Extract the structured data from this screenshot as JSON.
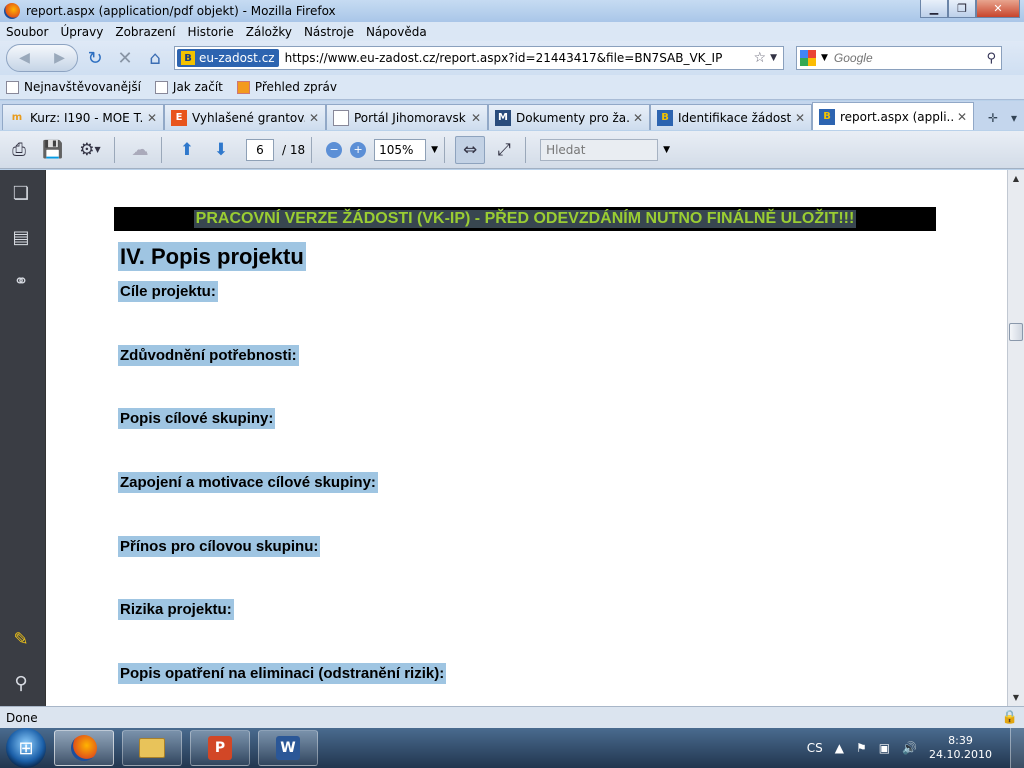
{
  "window": {
    "title": "report.aspx (application/pdf objekt) - Mozilla Firefox",
    "minimize": "▁",
    "maximize": "❐",
    "close": "✕"
  },
  "menu": [
    "Soubor",
    "Úpravy",
    "Zobrazení",
    "Historie",
    "Záložky",
    "Nástroje",
    "Nápověda"
  ],
  "nav": {
    "site_badge": "eu-zadost.cz",
    "url": "https://www.eu-zadost.cz/report.aspx?id=21443417&file=BN7SAB_VK_IP",
    "search_placeholder": "Google"
  },
  "bookmarks": [
    "Nejnavštěvovanější",
    "Jak začít",
    "Přehled zpráv"
  ],
  "tabs": [
    {
      "label": "Kurz: I190 - MOE T...",
      "icon": "moodle-icon"
    },
    {
      "label": "Vyhlašené grantov...",
      "icon": "e-logo-icon"
    },
    {
      "label": "Portál Jihomoravsk...",
      "icon": "page-icon"
    },
    {
      "label": "Dokumenty pro ža...",
      "icon": "msmt-icon"
    },
    {
      "label": "Identifikace žádosti",
      "icon": "b-logo-icon"
    },
    {
      "label": "report.aspx (appli...",
      "icon": "b-logo-icon"
    }
  ],
  "pdf_toolbar": {
    "page_current": "6",
    "page_total": "/ 18",
    "zoom": "105%",
    "find_placeholder": "Hledat"
  },
  "document": {
    "banner": "PRACOVNÍ VERZE ŽÁDOSTI (VK-IP) - PŘED ODEVZDÁNÍM NUTNO FINÁLNĚ ULOŽIT!!!",
    "section_title": "IV. Popis projektu",
    "fields": [
      "Cíle projektu:",
      "Zdůvodnění potřebnosti:",
      "Popis cílové skupiny:",
      "Zapojení a motivace cílové skupiny:",
      "Přínos pro cílovou skupinu:",
      "Rizika projektu:",
      "Popis opatření na eliminaci (odstranění rizik):"
    ]
  },
  "status": "Done",
  "taskbar": {
    "language": "CS",
    "time": "8:39",
    "date": "24.10.2010"
  },
  "colors": {
    "banner_bg": "#000000",
    "banner_text": "#9acd32",
    "highlight": "#9fc5e2"
  }
}
